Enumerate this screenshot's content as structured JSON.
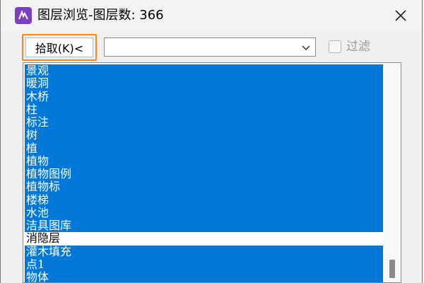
{
  "window": {
    "title": "图层浏览-图层数: 366"
  },
  "toolbar": {
    "pick_label": "拾取(K)<",
    "combo_value": "",
    "filter_label": "过滤"
  },
  "list": {
    "items": [
      {
        "label": "景观",
        "selected": true
      },
      {
        "label": "暖洞",
        "selected": true
      },
      {
        "label": "木桥",
        "selected": true
      },
      {
        "label": "柱",
        "selected": true
      },
      {
        "label": "标注",
        "selected": true
      },
      {
        "label": "树",
        "selected": true
      },
      {
        "label": "植",
        "selected": true
      },
      {
        "label": "植物",
        "selected": true
      },
      {
        "label": "植物图例",
        "selected": true
      },
      {
        "label": "植物标",
        "selected": true
      },
      {
        "label": "楼梯",
        "selected": true
      },
      {
        "label": "水池",
        "selected": true
      },
      {
        "label": "洁具图库",
        "selected": true
      },
      {
        "label": "消隐层",
        "selected": false
      },
      {
        "label": "灌木填充",
        "selected": true
      },
      {
        "label": "点1",
        "selected": true
      },
      {
        "label": "物体",
        "selected": true
      }
    ]
  },
  "colors": {
    "selection": "#0078d7",
    "highlight_border": "#f08a24"
  },
  "icons": {
    "app": "app-icon",
    "close": "close-icon",
    "dropdown": "chevron-down-icon"
  }
}
